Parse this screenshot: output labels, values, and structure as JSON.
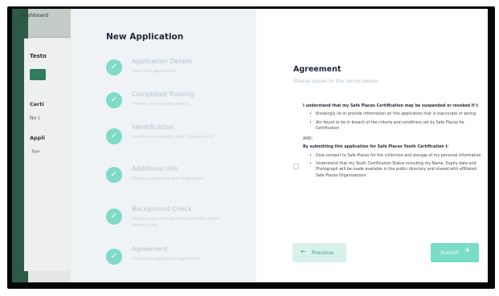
{
  "background": {
    "tab_label": "Dashboard",
    "card_title": "Testo",
    "cert_heading": "Certi",
    "cert_text": "No c",
    "apps_heading": "Appli",
    "type_label": "Type",
    "close_glyph": "×"
  },
  "stepper": {
    "title": "New Application",
    "steps": [
      {
        "title": "Application Details",
        "subtitle": "Start your application",
        "done": true
      },
      {
        "title": "Completed Training",
        "subtitle": "Provide your training details",
        "done": true
      },
      {
        "title": "Identification",
        "subtitle": "Confirm your identity with 3 pieces of ID",
        "done": true
      },
      {
        "title": "Additional Info",
        "subtitle": "Provide a headshot and fingerprints",
        "done": true
      },
      {
        "title": "Background Check",
        "subtitle": "Provide your criminal and vulnerable sector record check",
        "done": true
      },
      {
        "title": "Agreement",
        "subtitle": "Consent to application agreement",
        "done": true
      }
    ],
    "check_glyph": "✓"
  },
  "agreement": {
    "title": "Agreement",
    "subtitle": "Please agree to the terms below",
    "intro": "I understand that my Safe Places Certification may be suspended or revoked if I:",
    "bullets1": [
      "Knowingly lie or provide information on this application that is inaccurate or wrong",
      "Am found to be in breach of the criteria and conditions set by Safe Places for Certification"
    ],
    "and_label": "AND;",
    "consent_intro": "By submitting this application for Safe Places Youth Certification I:",
    "bullets2": [
      "Give consent to Safe Places for the collection and storage of my personal information",
      "Understand that my Youth Certification Status including my Name, Expiry date and Photograph will be made available in the public directory and shared with affiliated Safe Places Organizations"
    ],
    "checkbox_checked": false
  },
  "buttons": {
    "previous_label": "Previous",
    "previous_arrow": "←",
    "submit_label": "Submit",
    "submit_icon": "✈"
  },
  "colors": {
    "accent": "#7fdbc7",
    "brand_dark": "#2c5a46",
    "sidebar_bg": "#eff3f6"
  }
}
